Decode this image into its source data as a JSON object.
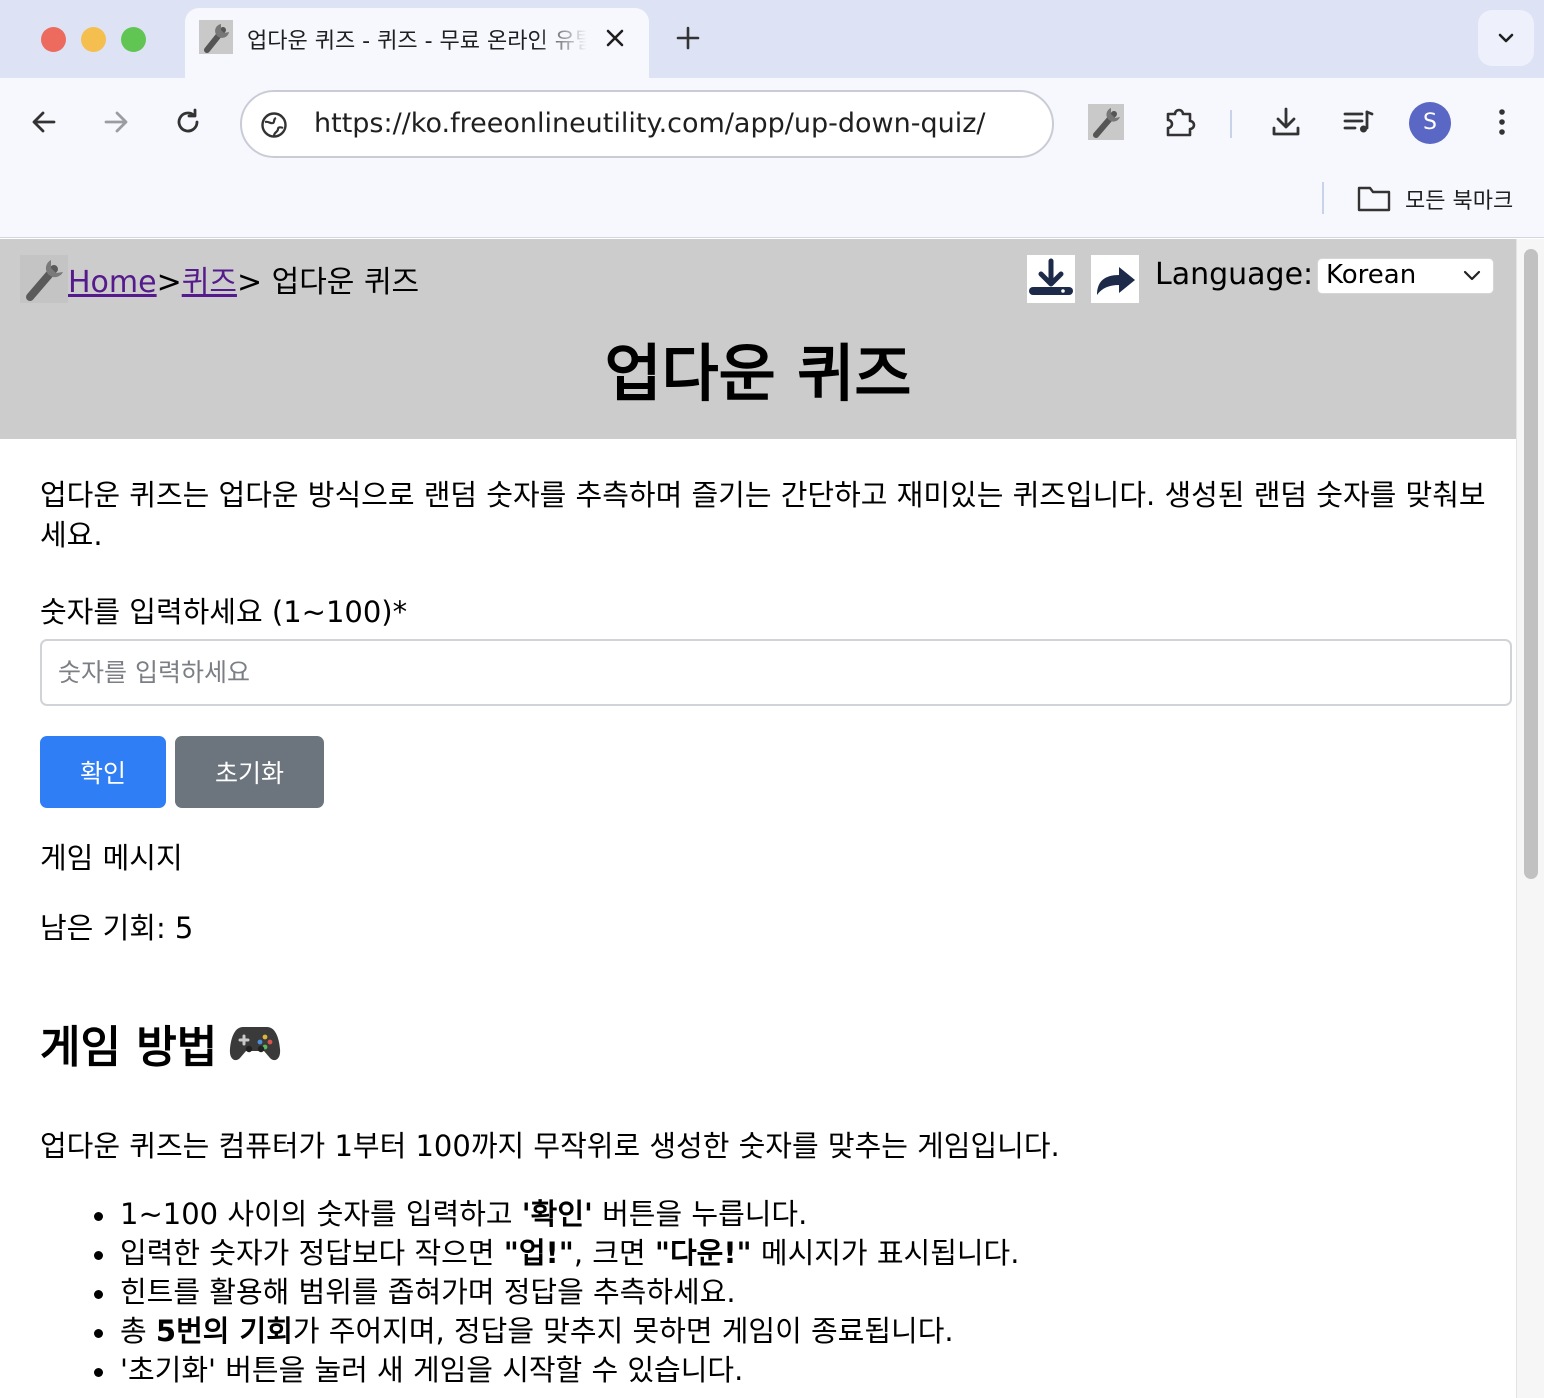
{
  "browser": {
    "tab_title": "업다운 퀴즈 - 퀴즈 - 무료 온라인 유틸리티",
    "url": "https://ko.freeonlineutility.com/app/up-down-quiz/",
    "avatar_letter": "S",
    "bookmarks_label": "모든 북마크"
  },
  "header": {
    "breadcrumb_home": "Home",
    "breadcrumb_sep1": ">",
    "breadcrumb_category": "퀴즈",
    "breadcrumb_current": "> 업다운 퀴즈",
    "language_label": "Language:",
    "language_value": "Korean",
    "title": "업다운 퀴즈"
  },
  "main": {
    "description": "업다운 퀴즈는 업다운 방식으로 랜덤 숫자를 추측하며 즐기는 간단하고 재미있는 퀴즈입니다. 생성된 랜덤 숫자를 맞춰보세요.",
    "input_label": "숫자를 입력하세요 (1~100)*",
    "input_placeholder": "숫자를 입력하세요",
    "input_value": "",
    "confirm_button": "확인",
    "reset_button": "초기화",
    "game_message": "게임 메시지",
    "remaining_chances": "남은 기회: 5"
  },
  "how_to": {
    "title": "게임 방법",
    "intro": "업다운 퀴즈는 컴퓨터가 1부터 100까지 무작위로 생성한 숫자를 맞추는 게임입니다.",
    "rules": [
      {
        "pre": "1~100 사이의 숫자를 입력하고 ",
        "bold": "'확인'",
        "post": " 버튼을 누릅니다."
      },
      {
        "pre": "입력한 숫자가 정답보다 작으면 ",
        "bold": "\"업!\"",
        "mid": ", 크면 ",
        "bold2": "\"다운!\"",
        "post": " 메시지가 표시됩니다."
      },
      {
        "pre": "힌트를 활용해 범위를 좁혀가며 정답을 추측하세요."
      },
      {
        "pre": "총 ",
        "bold": "5번의 기회",
        "post": "가 주어지며, 정답을 맞추지 못하면 게임이 종료됩니다."
      },
      {
        "pre": "'초기화' 버튼을 눌러 새 게임을 시작할 수 있습니다."
      }
    ]
  },
  "colors": {
    "primary_button": "#2f7ef5",
    "secondary_button": "#6c757d",
    "header_bg": "#cccccc",
    "link_visited": "#551a8b"
  }
}
